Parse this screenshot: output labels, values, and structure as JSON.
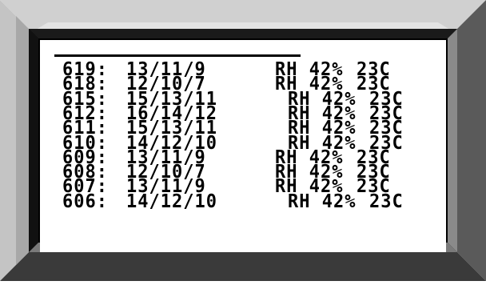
{
  "display": {
    "rows": [
      {
        "id": "619:",
        "values": "13/11/9",
        "rh": "RH 42%",
        "temp": "23C",
        "shift": 0
      },
      {
        "id": "618:",
        "values": "12/10/7",
        "rh": "RH 42%",
        "temp": "23C",
        "shift": 0
      },
      {
        "id": "615:",
        "values": "15/13/11",
        "rh": "RH 42%",
        "temp": "23C",
        "shift": 1
      },
      {
        "id": "612:",
        "values": "16/14/12",
        "rh": "RH 42%",
        "temp": "23C",
        "shift": 1
      },
      {
        "id": "611:",
        "values": "15/13/11",
        "rh": "RH 42%",
        "temp": "23C",
        "shift": 1
      },
      {
        "id": "610:",
        "values": "14/12/10",
        "rh": "RH 42%",
        "temp": "23C",
        "shift": 1
      },
      {
        "id": "609:",
        "values": "13/11/9",
        "rh": "RH 42%",
        "temp": "23C",
        "shift": 0
      },
      {
        "id": "608:",
        "values": "12/10/7",
        "rh": "RH 42%",
        "temp": "23C",
        "shift": 0
      },
      {
        "id": "607:",
        "values": "13/11/9",
        "rh": "RH 42%",
        "temp": "23C",
        "shift": 0
      },
      {
        "id": "606:",
        "values": "14/12/10",
        "rh": "RH 42%",
        "temp": "23C",
        "shift": 1
      }
    ]
  },
  "colors": {
    "bevel_light": "#d6d6d6",
    "bevel_mid": "#9e9e9e",
    "bevel_dark": "#3c3c3c",
    "screen_border": "#000000",
    "screen_bg": "#ffffff",
    "text": "#000000"
  }
}
